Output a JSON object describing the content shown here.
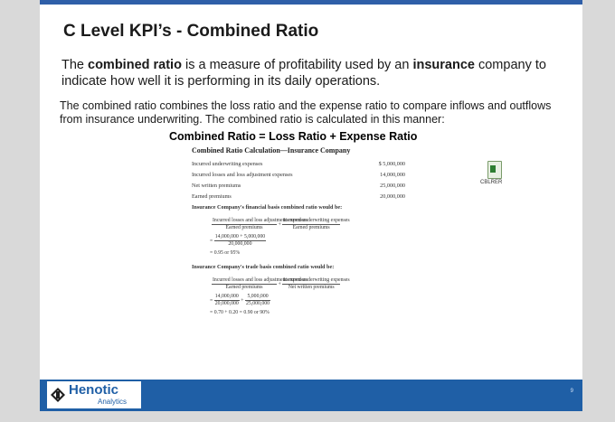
{
  "slide": {
    "title": "C Level KPI’s - Combined Ratio",
    "p1": {
      "t1": "The ",
      "b1": "combined ratio",
      "t2": " is a measure of profitability used by an ",
      "b2": "insurance",
      "t3": " company to indicate how well it is performing in its daily operations."
    },
    "p2": "The combined ratio combines the loss ratio and the expense ratio to compare inflows and outflows from insurance underwriting.  The combined ratio is calculated in this manner:",
    "formula": "Combined Ratio = Loss Ratio + Expense Ratio"
  },
  "calc": {
    "title": "Combined Ratio Calculation—Insurance Company",
    "rows": [
      {
        "label": "Incurred underwriting expenses",
        "value": "$ 5,000,000"
      },
      {
        "label": "Incurred losses and loss adjustment expenses",
        "value": "14,000,000"
      },
      {
        "label": "Net written premiums",
        "value": "25,000,000"
      },
      {
        "label": "Earned premiums",
        "value": "20,000,000"
      }
    ],
    "financial_heading": "Insurance Company's financial basis combined ratio would be:",
    "fin_num1": "Incurred losses and loss adjustment expenses",
    "fin_den1": "Earned premiums",
    "fin_num2": "Incurred underwriting expenses",
    "fin_den2": "Earned premiums",
    "fin_step_num": "14,000,000 + 5,000,000",
    "fin_step_den": "20,000,000",
    "fin_result": "= 0.95 or 95%",
    "trade_heading": "Insurance Company's trade basis combined ratio would be:",
    "tr_num1": "Incurred losses and loss adjustment expenses",
    "tr_den1": "Earned premiums",
    "tr_num2": "Incurred underwriting expenses",
    "tr_den2": "Net written premiums",
    "tr_step_n1": "14,000,000",
    "tr_step_d1": "20,000,000",
    "tr_step_n2": "5,000,000",
    "tr_step_d2": "25,000,000",
    "tr_result": "= 0.70 + 0.20 = 0.90 or 90%"
  },
  "attachment": {
    "icon": "spreadsheet-icon",
    "caption": "CBLRER"
  },
  "footer": {
    "brand": "Henotic",
    "sub": "Analytics",
    "page": "9",
    "color": "#1f5fa6"
  }
}
